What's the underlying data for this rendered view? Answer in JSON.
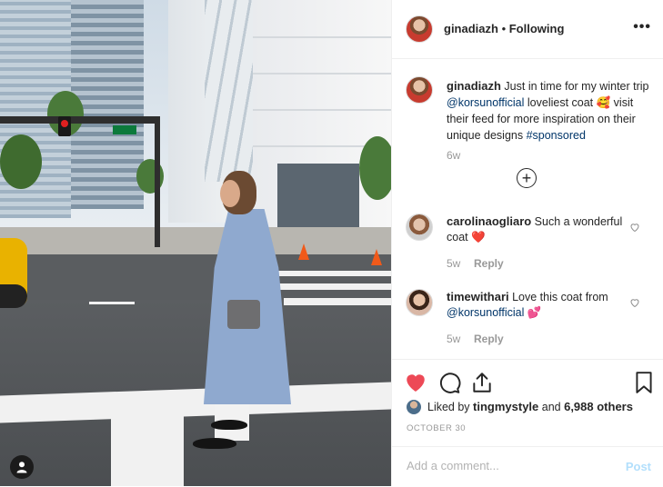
{
  "photo": {
    "scene": "woman in blue coat crossing street",
    "user_tag_icon": "person-icon"
  },
  "header": {
    "username": "ginadiazh",
    "separator": " • ",
    "follow_status": "Following",
    "more_icon": "more-options-icon",
    "more_label": "•••"
  },
  "caption": {
    "username": "ginadiazh",
    "text_1": " Just in time for my winter trip ",
    "mention": "@korsunofficial",
    "text_2": " loveliest coat 🥰 visit their feed for more inspiration on their unique designs ",
    "hashtag": "#sponsored",
    "time": "6w"
  },
  "load_more_icon": "plus-circle-icon",
  "comments": [
    {
      "username": "carolinaogliaro",
      "text": " Such a wonderful coat ❤️",
      "time": "5w",
      "reply": "Reply"
    },
    {
      "username": "timewithari",
      "text": " Love this coat from ",
      "mention": "@korsunofficial",
      "emoji": " 💕",
      "time": "5w",
      "reply": "Reply"
    }
  ],
  "actions": {
    "like_icon": "heart-filled-icon",
    "comment_icon": "comment-icon",
    "share_icon": "share-icon",
    "save_icon": "bookmark-icon",
    "like_color": "#ed4956"
  },
  "likes": {
    "prefix": "Liked by ",
    "user": "tingmystyle",
    "middle": " and ",
    "others": "6,988 others"
  },
  "date": "OCTOBER 30",
  "composer": {
    "placeholder": "Add a comment...",
    "post_label": "Post"
  }
}
